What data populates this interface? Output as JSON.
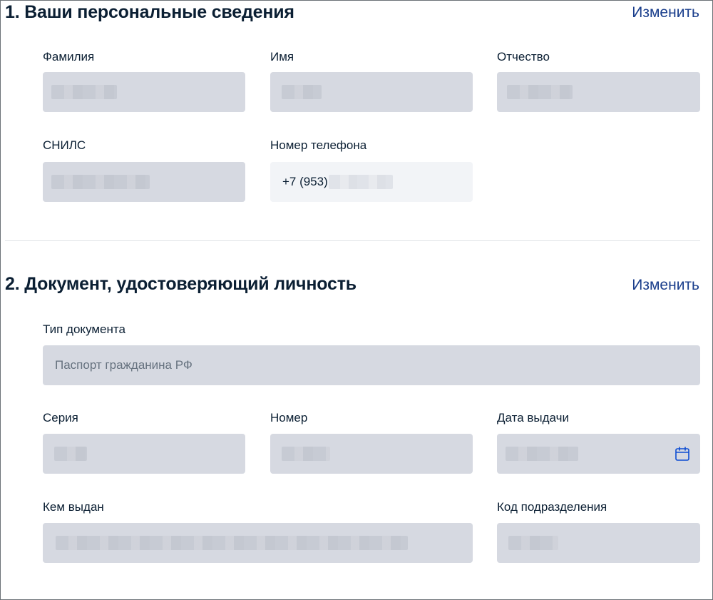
{
  "section1": {
    "title": "1. Ваши персональные сведения",
    "edit_label": "Изменить",
    "fields": {
      "last_name_label": "Фамилия",
      "first_name_label": "Имя",
      "patronymic_label": "Отчество",
      "snils_label": "СНИЛС",
      "phone_label": "Номер телефона",
      "phone_value": "+7 (953)"
    }
  },
  "section2": {
    "title": "2. Документ, удостоверяющий личность",
    "edit_label": "Изменить",
    "fields": {
      "doc_type_label": "Тип документа",
      "doc_type_value": "Паспорт гражданина РФ",
      "series_label": "Серия",
      "number_label": "Номер",
      "issue_date_label": "Дата выдачи",
      "issued_by_label": "Кем выдан",
      "division_code_label": "Код подразделения"
    }
  },
  "icons": {
    "issue_date": "calendar-icon"
  },
  "colors": {
    "link": "#1a3e8c",
    "field_disabled": "#d6d9e1",
    "field_light": "#f2f4f7",
    "text": "#0b1f33"
  }
}
